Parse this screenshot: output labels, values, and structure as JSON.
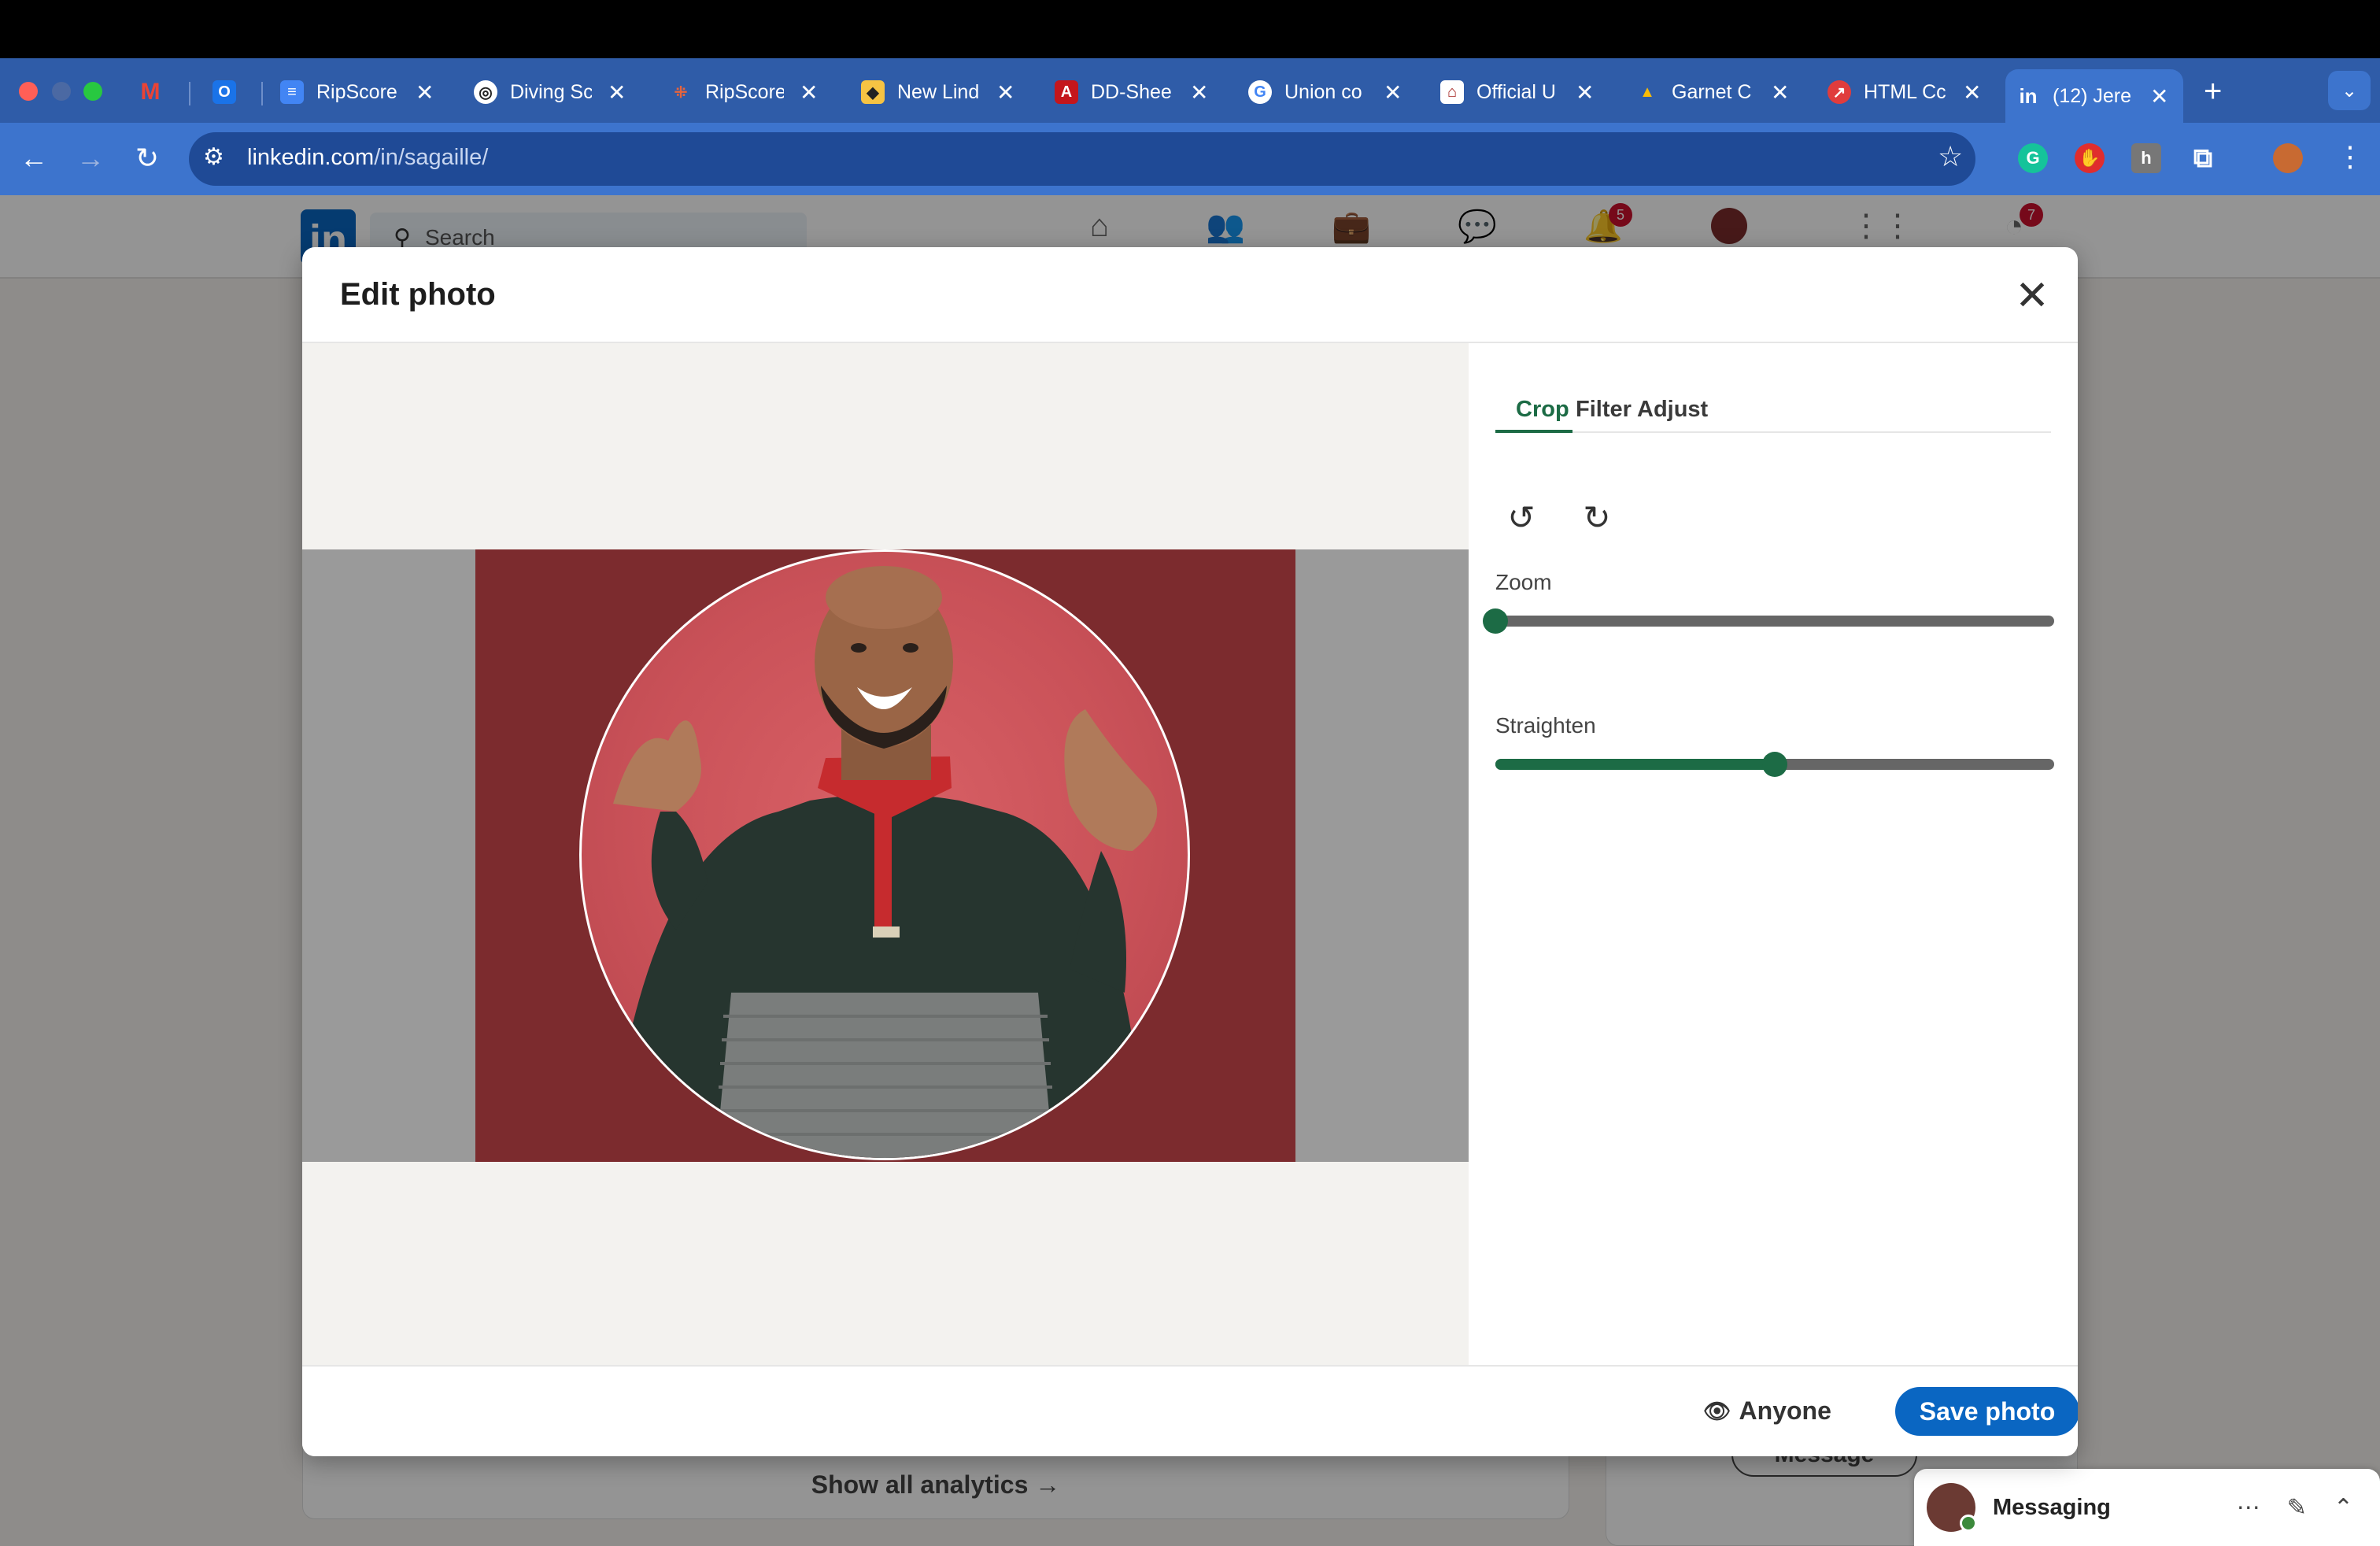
{
  "browser": {
    "tabs": [
      {
        "title": "",
        "icon": "gmail-icon"
      },
      {
        "title": "",
        "icon": "outlook-icon"
      },
      {
        "title": "RipScore",
        "icon": "docs-icon"
      },
      {
        "title": "Diving Sc",
        "icon": "openai-icon"
      },
      {
        "title": "RipScore",
        "icon": "ripscore-icon"
      },
      {
        "title": "New Lind",
        "icon": "new-lind-icon"
      },
      {
        "title": "DD-Shee",
        "icon": "pdf-icon"
      },
      {
        "title": "Union co",
        "icon": "google-icon"
      },
      {
        "title": "Official U",
        "icon": "university-icon"
      },
      {
        "title": "Garnet C",
        "icon": "drive-icon"
      },
      {
        "title": "HTML Cc",
        "icon": "html-icon"
      },
      {
        "title": "(12) Jere",
        "icon": "linkedin-icon"
      }
    ],
    "url_host": "linkedin.com",
    "url_path": "/in/sagaille/",
    "new_tab": "+",
    "colors": {
      "tabstrip": "#2f5ca8",
      "toolbar": "#3d74cd"
    }
  },
  "linkedin": {
    "logo": "in",
    "search_placeholder": "Search",
    "notifications_badge": "5",
    "premium_badge": "7",
    "show_analytics": "Show all analytics →",
    "message_button": "Message",
    "messaging_label": "Messaging"
  },
  "modal": {
    "title": "Edit photo",
    "tabs": [
      "Crop",
      "Filter",
      "Adjust"
    ],
    "active_tab": "Crop",
    "zoom_label": "Zoom",
    "zoom_value": 0.0,
    "straighten_label": "Straighten",
    "straighten_value": 0.5,
    "visibility": "Anyone",
    "save_label": "Save photo",
    "accent": "#1c6b45",
    "save_color": "#0a66c2"
  }
}
